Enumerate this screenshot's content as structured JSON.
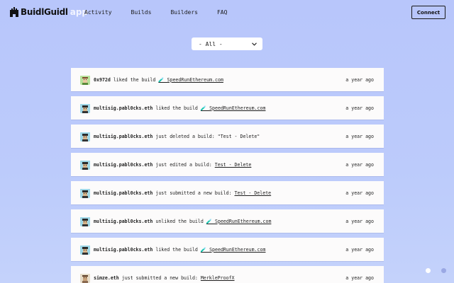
{
  "header": {
    "logo_text": "BuidlGuidl",
    "logo_app": "app",
    "nav": [
      "Activity",
      "Builds",
      "Builders",
      "FAQ"
    ],
    "connect_label": "Connect"
  },
  "filter": {
    "selected": "- All -"
  },
  "feed": [
    {
      "avatar": "green",
      "user": "0x972d",
      "action": "liked the build",
      "target": "🧪 SpeedRunEthereum.com",
      "target_type": "link",
      "time": "a year ago"
    },
    {
      "avatar": "teal",
      "user": "multisig.pabl0cks.eth",
      "action": "liked the build",
      "target": "🧪 SpeedRunEthereum.com",
      "target_type": "link",
      "time": "a year ago"
    },
    {
      "avatar": "teal",
      "user": "multisig.pabl0cks.eth",
      "action": "just deleted a build:",
      "target": "\"Test - Delete\"",
      "target_type": "text",
      "time": "a year ago"
    },
    {
      "avatar": "teal",
      "user": "multisig.pabl0cks.eth",
      "action": "just edited a build:",
      "target": "Test - Delete",
      "target_type": "link",
      "time": "a year ago"
    },
    {
      "avatar": "teal",
      "user": "multisig.pabl0cks.eth",
      "action": "just submitted a new build:",
      "target": "Test - Delete",
      "target_type": "link",
      "time": "a year ago"
    },
    {
      "avatar": "teal",
      "user": "multisig.pabl0cks.eth",
      "action": "unliked the build",
      "target": "🧪 SpeedRunEthereum.com",
      "target_type": "link",
      "time": "a year ago"
    },
    {
      "avatar": "teal",
      "user": "multisig.pabl0cks.eth",
      "action": "liked the build",
      "target": "🧪 SpeedRunEthereum.com",
      "target_type": "link",
      "time": "a year ago"
    },
    {
      "avatar": "beige",
      "user": "simze.eth",
      "action": "just submitted a new build:",
      "target": "MerkleProofX",
      "target_type": "link",
      "time": "a year ago"
    }
  ],
  "colors": {
    "background": "#b8c6fb",
    "card": "#fcfbfb",
    "text": "#1a1a1a"
  },
  "icons": {
    "filter": "chevron-down-icon",
    "logo": "castle-icon"
  }
}
